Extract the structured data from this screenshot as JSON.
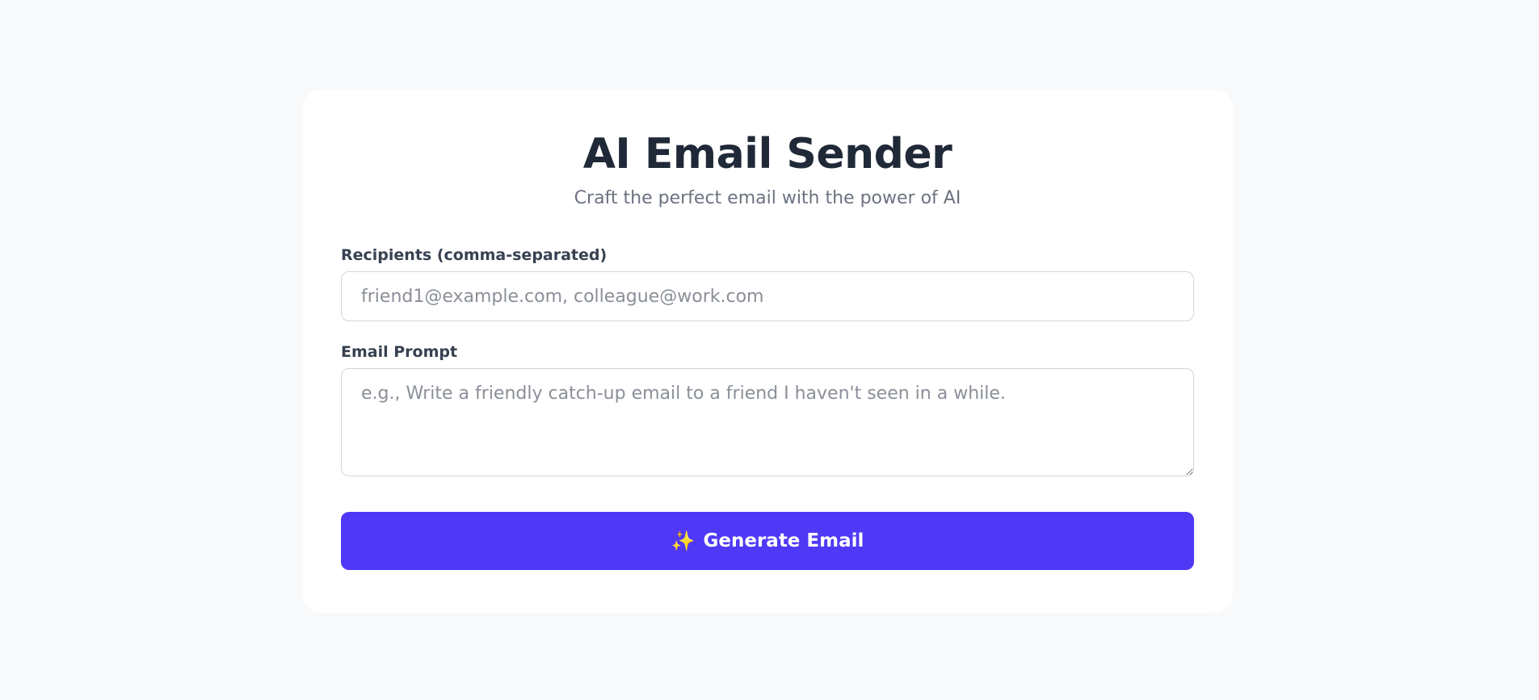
{
  "header": {
    "title": "AI Email Sender",
    "subtitle": "Craft the perfect email with the power of AI"
  },
  "form": {
    "recipients": {
      "label": "Recipients (comma-separated)",
      "placeholder": "friend1@example.com, colleague@work.com",
      "value": ""
    },
    "prompt": {
      "label": "Email Prompt",
      "placeholder": "e.g., Write a friendly catch-up email to a friend I haven't seen in a while.",
      "value": ""
    },
    "submit": {
      "icon": "sparkles-icon",
      "glyph": "✨",
      "label": "Generate Email"
    }
  },
  "colors": {
    "background": "#f8f9fb",
    "card": "#ffffff",
    "primary": "#4f38f6",
    "title": "#1f2937",
    "muted": "#6b7280"
  }
}
